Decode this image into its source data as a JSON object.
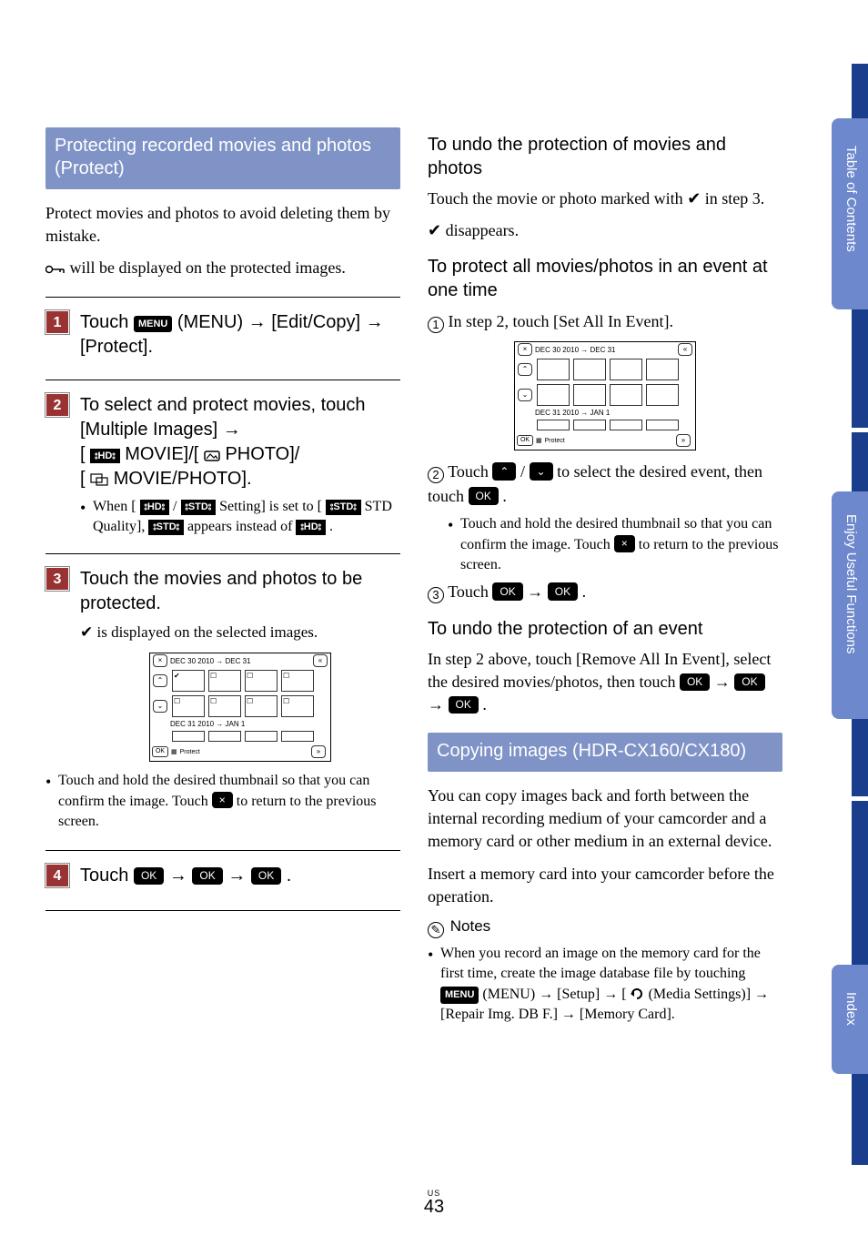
{
  "tabs": {
    "toc": "Table of Contents",
    "functions": "Enjoy Useful Functions",
    "index": "Index"
  },
  "page": {
    "us": "US",
    "num": "43"
  },
  "left": {
    "section_title": "Protecting recorded movies and photos (Protect)",
    "intro1": "Protect movies and photos to avoid deleting them by mistake.",
    "intro2_suffix": " will be displayed on the protected images.",
    "step1": {
      "num": "1",
      "prefix": "Touch ",
      "menu_pill": "MENU",
      "after_menu": " (MENU) ",
      "arrow": "→",
      "seg1": " [Edit/Copy] ",
      "seg2": " [Protect]."
    },
    "step2": {
      "num": "2",
      "line1": "To select and protect movies, touch [Multiple Images] ",
      "arrow": "→",
      "line2_prefix": " [",
      "hd_label": "HD",
      "line2_movie": " MOVIE]/[",
      "photo_label": "PHOTO]/",
      "line3_prefix": "[",
      "line3_text": " MOVIE/PHOTO].",
      "bullet_prefix": "When [",
      "bullet_hd": "HD",
      "bullet_slash": " / ",
      "bullet_std": "STD",
      "bullet_mid": " Setting] is set to [",
      "bullet_std2": "STD",
      "bullet_mid2": " STD Quality], ",
      "bullet_std3": "STD",
      "bullet_end": " appears instead of ",
      "bullet_hd2": "HD",
      "bullet_period": "."
    },
    "step3": {
      "num": "3",
      "title": "Touch the movies and photos to be protected.",
      "check_text": " is displayed on the selected images."
    },
    "screen": {
      "close": "×",
      "date1": "DEC 30 2010 → DEC 31",
      "up": "⌃",
      "down": "⌄",
      "date2": "DEC 31 2010 → JAN 1",
      "ok": "OK",
      "foot_label": "Protect",
      "scroll_up": "«",
      "scroll_down": "»"
    },
    "after_screen_bullet_1": "Touch and hold the desired thumbnail so that you can confirm the image. Touch ",
    "after_screen_bullet_2": " to return to the previous screen.",
    "close_pill": "×",
    "step4": {
      "num": "4",
      "prefix": "Touch ",
      "ok": "OK",
      "arrow": "→",
      "period": "."
    }
  },
  "right": {
    "sub1": "To undo the protection of movies and photos",
    "sub1_p1_a": "Touch the movie or photo marked with ",
    "check": "✔",
    "sub1_p1_b": " in step 3.",
    "sub1_p2": " disappears.",
    "sub2": "To protect all movies/photos in an event at one time",
    "c1_text": "In step 2, touch [Set All In Event].",
    "c2_prefix": "Touch ",
    "up_pill": "⌃",
    "slash": " / ",
    "down_pill": "⌄",
    "c2_mid": " to select the desired event, then touch ",
    "ok": "OK",
    "c2_period": ".",
    "c2_bullet_a": "Touch and hold the desired thumbnail so that you can confirm the image. Touch ",
    "c2_bullet_b": " to return to the previous screen.",
    "close_pill": "×",
    "c3_prefix": "Touch ",
    "c3_arrow": "→",
    "c3_period": ".",
    "sub3": "To undo the protection of an event",
    "sub3_body_a": "In step 2 above, touch [Remove All In Event], select the desired movies/photos, then touch ",
    "sub3_arrow": "→",
    "sub3_period": ".",
    "section2_title": "Copying images (HDR-CX160/CX180)",
    "section2_p1": "You can copy images back and forth between the internal recording medium of your camcorder and a memory card or other medium in an external device.",
    "section2_p2": "Insert a memory card into your camcorder before the operation.",
    "notes_label": "Notes",
    "note_bullet_a": "When you record an image on the memory card for the first time, create the image database file by touching ",
    "menu_pill": "MENU",
    "note_bullet_b": " (MENU) ",
    "note_arrow": "→",
    "note_bullet_c": " [Setup] ",
    "note_bullet_d": " [",
    "note_bullet_e": " (Media Settings)] ",
    "note_bullet_f": " [Repair Img. DB F.] ",
    "note_bullet_g": " [Memory Card]."
  }
}
